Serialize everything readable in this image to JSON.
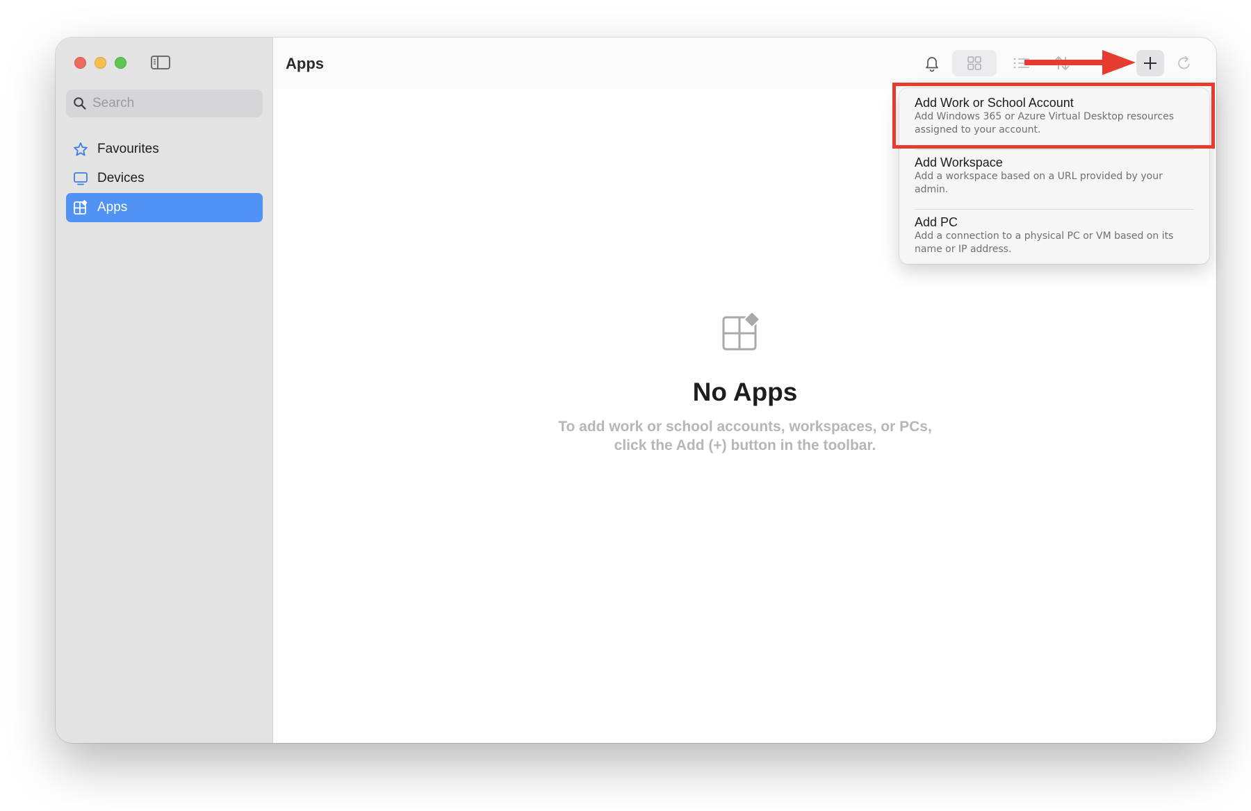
{
  "window": {
    "sidebar": {
      "search_placeholder": "Search",
      "items": [
        {
          "label": "Favourites",
          "icon": "star-icon"
        },
        {
          "label": "Devices",
          "icon": "monitor-icon"
        },
        {
          "label": "Apps",
          "icon": "apps-icon",
          "selected": true
        }
      ]
    },
    "main": {
      "title": "Apps",
      "toolbar_icons": [
        "bell-icon",
        "grid-view-icon",
        "list-view-icon",
        "sort-icon",
        "plus-icon",
        "refresh-icon"
      ],
      "empty_state": {
        "title": "No Apps",
        "line1": "To add work or school accounts, workspaces, or PCs,",
        "line2": "click the Add (+) button in the toolbar."
      }
    },
    "add_menu": {
      "items": [
        {
          "title": "Add Work or School Account",
          "desc_line1": "Add Windows 365 or Azure Virtual Desktop resources",
          "desc_line2": "assigned to your account."
        },
        {
          "title": "Add Workspace",
          "desc_line1": "Add a workspace based on a URL provided by your",
          "desc_line2": "admin."
        },
        {
          "title": "Add PC",
          "desc_line1": "Add a connection to a physical PC or VM based on its",
          "desc_line2": "name or IP address."
        }
      ]
    }
  },
  "colors": {
    "accent": "#5192f5",
    "annotation_red": "#e63c2f",
    "sidebar_bg": "#e3e3e4"
  }
}
